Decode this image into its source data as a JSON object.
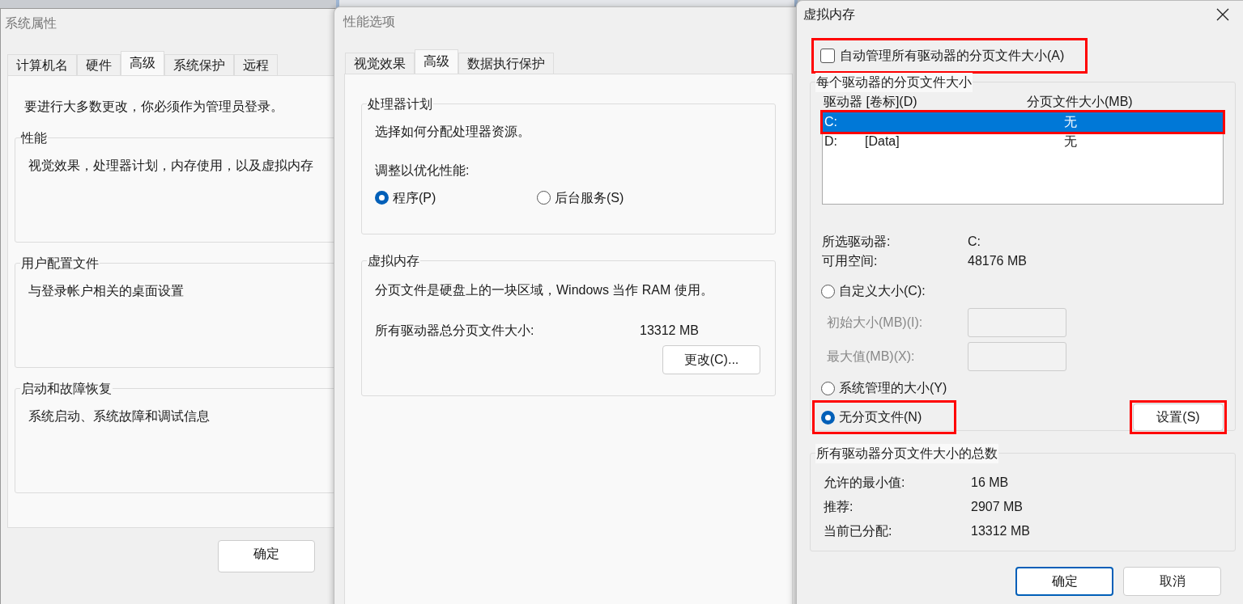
{
  "system_properties": {
    "title": "系统属性",
    "tabs": [
      {
        "label": "计算机名",
        "selected": false
      },
      {
        "label": "硬件",
        "selected": false
      },
      {
        "label": "高级",
        "selected": true
      },
      {
        "label": "系统保护",
        "selected": false
      },
      {
        "label": "远程",
        "selected": false
      }
    ],
    "notice": "要进行大多数更改，你必须作为管理员登录。",
    "groups": [
      {
        "title": "性能",
        "text": "视觉效果，处理器计划，内存使用，以及虚拟内存"
      },
      {
        "title": "用户配置文件",
        "text": "与登录帐户相关的桌面设置"
      },
      {
        "title": "启动和故障恢复",
        "text": "系统启动、系统故障和调试信息"
      }
    ],
    "buttons": [
      "确定"
    ]
  },
  "performance_options": {
    "title": "性能选项",
    "tabs": [
      {
        "label": "视觉效果",
        "selected": false
      },
      {
        "label": "高级",
        "selected": true
      },
      {
        "label": "数据执行保护",
        "selected": false
      }
    ],
    "processor": {
      "title": "处理器计划",
      "text": "选择如何分配处理器资源。",
      "adjust_label": "调整以优化性能:",
      "radios": [
        {
          "label": "程序(P)",
          "selected": true
        },
        {
          "label": "后台服务(S)",
          "selected": false
        }
      ]
    },
    "virtual_memory": {
      "title": "虚拟内存",
      "text": "分页文件是硬盘上的一块区域，Windows 当作 RAM 使用。",
      "total_label": "所有驱动器总分页文件大小:",
      "total_value": "13312 MB",
      "change_button": "更改(C)..."
    }
  },
  "virtual_memory": {
    "title": "虚拟内存",
    "auto_manage": {
      "label": "自动管理所有驱动器的分页文件大小(A)",
      "checked": false,
      "highlighted": true
    },
    "per_drive": {
      "title": "每个驱动器的分页文件大小",
      "columns": [
        "驱动器 [卷标](D)",
        "分页文件大小(MB)"
      ],
      "drives": [
        {
          "drive": "C:",
          "size": "无",
          "selected": true,
          "highlighted": true
        },
        {
          "drive": "D:",
          "label": "[Data]",
          "size": "无",
          "selected": false,
          "highlighted": false
        }
      ],
      "info": [
        {
          "label": "所选驱动器:",
          "value": "C:"
        },
        {
          "label": "可用空间:",
          "value": "48176 MB"
        }
      ],
      "options": [
        {
          "kind": "radio",
          "label": "自定义大小(C):",
          "selected": false
        },
        {
          "kind": "field",
          "label": "初始大小(MB)(I):",
          "disabled": true
        },
        {
          "kind": "field",
          "label": "最大值(MB)(X):",
          "disabled": true
        },
        {
          "kind": "radio",
          "label": "系统管理的大小(Y)",
          "selected": false
        },
        {
          "kind": "radio",
          "label": "无分页文件(N)",
          "selected": true,
          "highlighted": true
        }
      ],
      "set_button": {
        "label": "设置(S)",
        "highlighted": true
      }
    },
    "totals": {
      "title": "所有驱动器分页文件大小的总数",
      "rows": [
        {
          "label": "允许的最小值:",
          "value": "16 MB"
        },
        {
          "label": "推荐:",
          "value": "2907 MB"
        },
        {
          "label": "当前已分配:",
          "value": "13312 MB"
        }
      ]
    },
    "buttons": [
      {
        "label": "确定",
        "primary": true
      },
      {
        "label": "取消",
        "primary": false
      }
    ]
  }
}
